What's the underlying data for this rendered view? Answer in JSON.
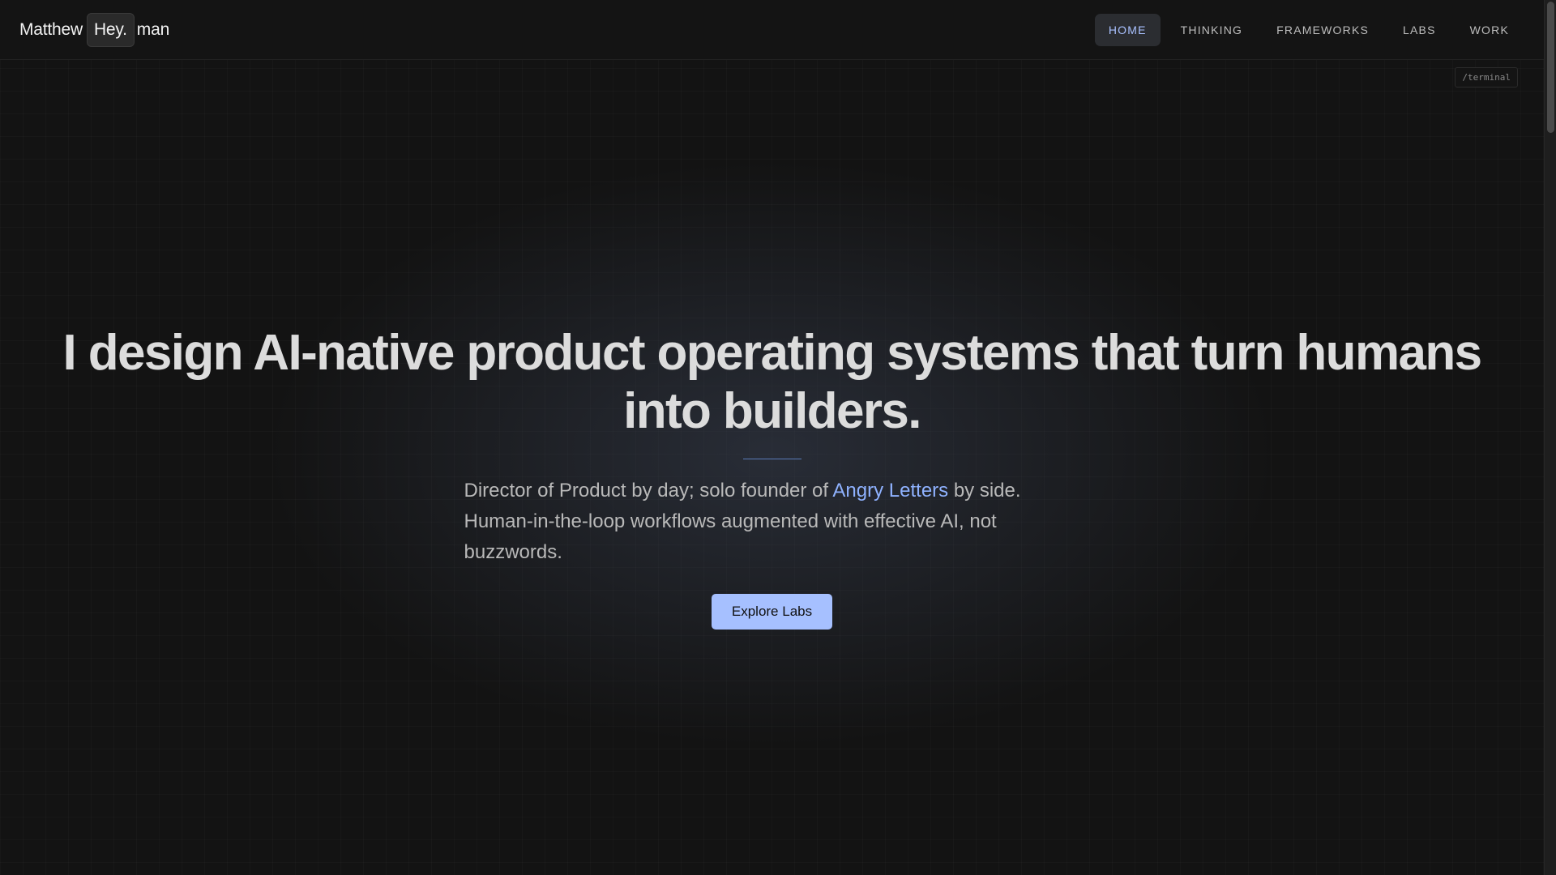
{
  "brand": {
    "first": "Matthew",
    "badge": "Hey.",
    "last": "man"
  },
  "nav": {
    "items": [
      {
        "label": "HOME",
        "active": true
      },
      {
        "label": "THINKING",
        "active": false
      },
      {
        "label": "FRAMEWORKS",
        "active": false
      },
      {
        "label": "LABS",
        "active": false
      },
      {
        "label": "WORK",
        "active": false
      }
    ]
  },
  "terminal_link": "/terminal",
  "hero": {
    "headline": "I design AI-native product operating systems that turn humans into builders.",
    "sub_before": "Director of Product by day; solo founder of ",
    "sub_link": "Angry Letters",
    "sub_after": " by side. Human-in-the-loop workflows augmented with effective AI, not buzzwords.",
    "cta": "Explore Labs"
  },
  "colors": {
    "background": "#121212",
    "accent": "#a6c0ff",
    "link": "#8fb2ff",
    "nav_active_text": "#a9c1ff"
  }
}
